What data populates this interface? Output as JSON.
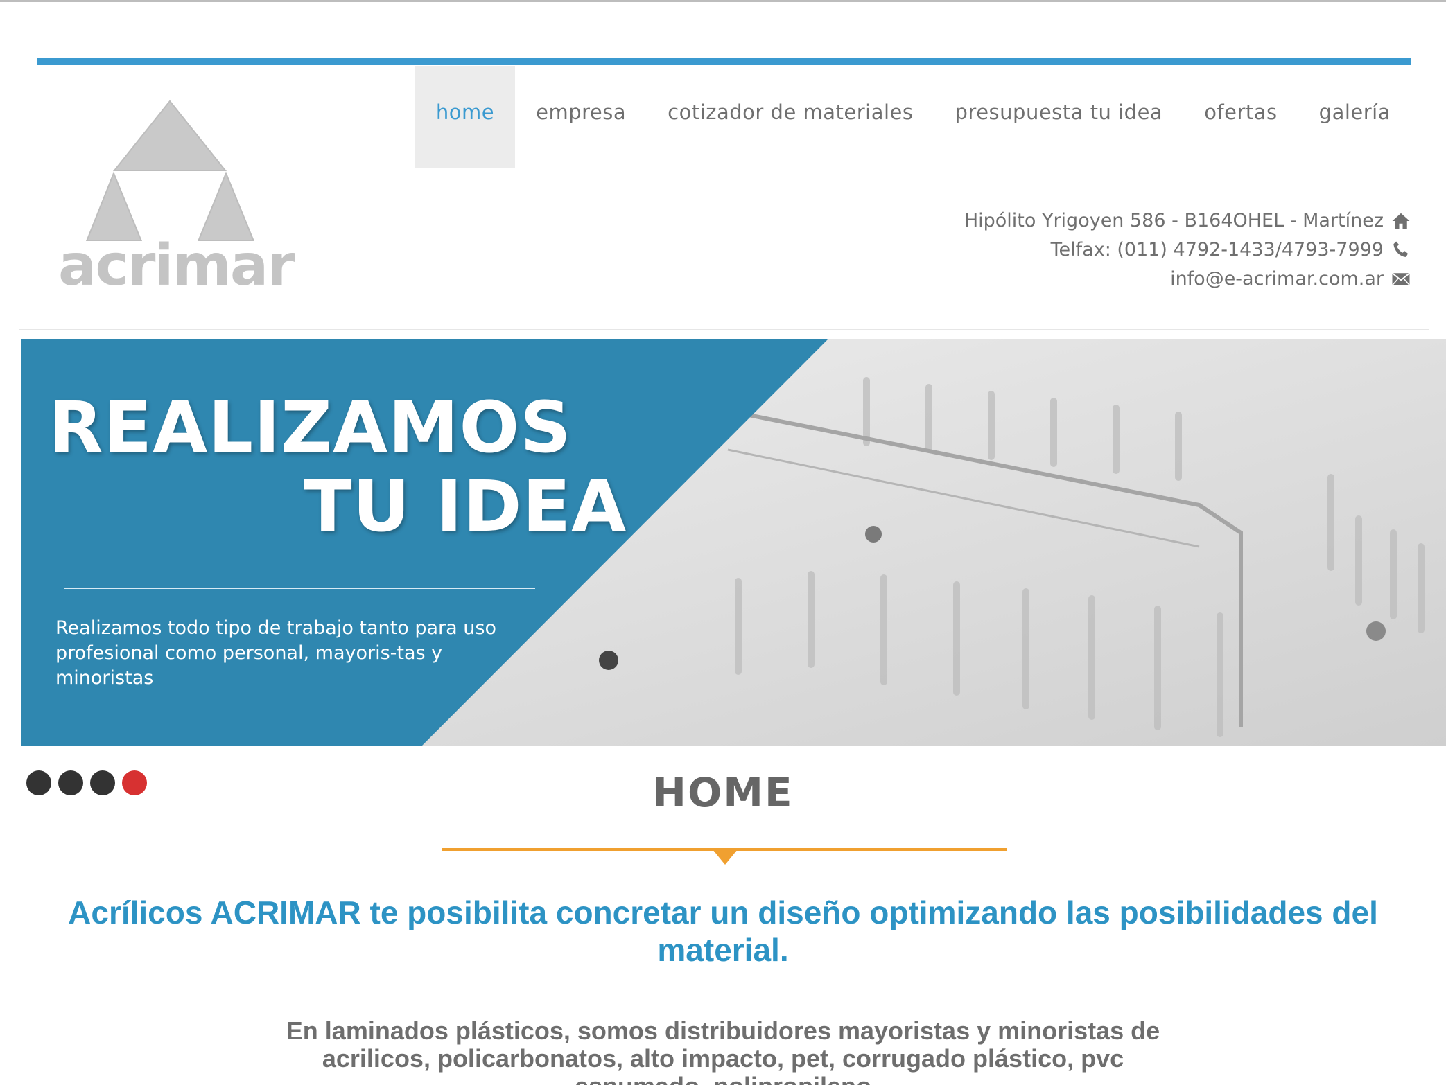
{
  "brand": {
    "logo_text": "acrimar",
    "accent_color": "#3b9ad0",
    "logo_color": "#c4c4c4"
  },
  "nav": {
    "items": [
      {
        "label": "home",
        "active": true
      },
      {
        "label": "empresa",
        "active": false
      },
      {
        "label": "cotizador de materiales",
        "active": false
      },
      {
        "label": "presupuesta tu idea",
        "active": false
      },
      {
        "label": "ofertas",
        "active": false
      },
      {
        "label": "galería",
        "active": false
      }
    ]
  },
  "contact": {
    "address": "Hipólito Yrigoyen 586 - B164OHEL - Martínez",
    "address_icon": "home-icon",
    "phone": "Telfax: (011) 4792-1433/4793-7999",
    "phone_icon": "phone-icon",
    "email": "info@e-acrimar.com.ar",
    "email_icon": "envelope-icon"
  },
  "banner": {
    "title_line1": "REALIZAMOS",
    "title_line2": "TU IDEA",
    "text": "Realizamos todo tipo de trabajo tanto para uso profesional como personal, mayoris-tas y minoristas",
    "panel_color": "#2f87b0"
  },
  "slider": {
    "total": 4,
    "active_index": 3,
    "active_color": "#d73131"
  },
  "main": {
    "page_title": "HOME",
    "headline": "Acrílicos ACRIMAR te posibilita concretar un diseño optimizando las posibilidades del material.",
    "body": "En laminados plásticos, somos distribuidores mayoristas y minoristas de acrilicos, policarbonatos, alto impacto, pet, corrugado plástico, pvc espumado, polipropileno",
    "divider_color": "#f0a030"
  }
}
